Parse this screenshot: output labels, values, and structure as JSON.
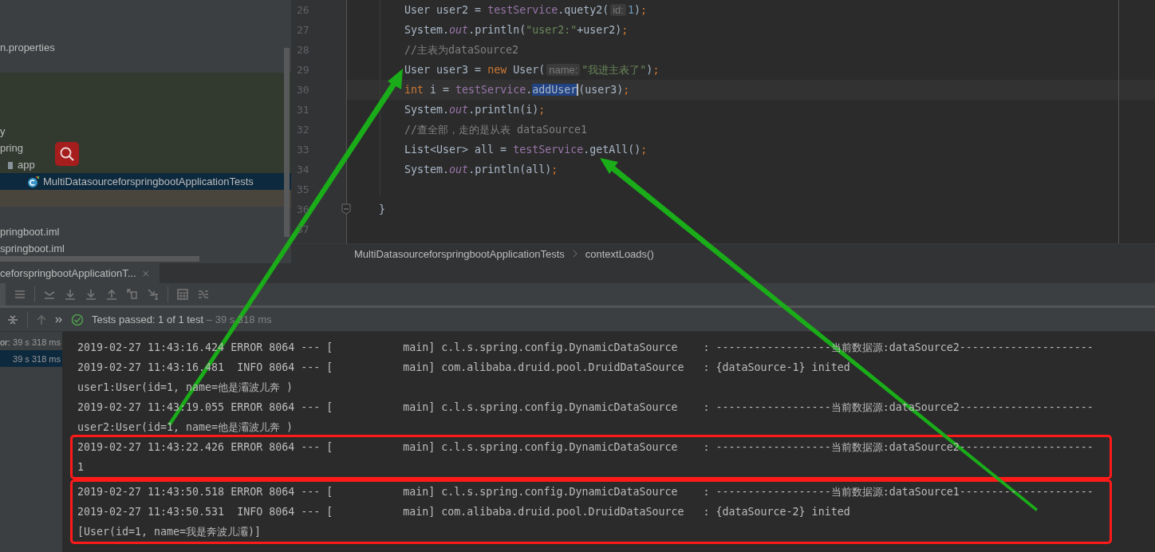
{
  "project_tree": {
    "items": [
      {
        "kind": "file",
        "label": "n.properties",
        "selected": false
      },
      {
        "kind": "blank",
        "selected": false
      },
      {
        "kind": "blank",
        "color": "#323a2f",
        "selected": false
      },
      {
        "kind": "blank",
        "color": "#323a2f",
        "selected": false
      },
      {
        "kind": "blank",
        "color": "#323a2f",
        "selected": false
      },
      {
        "kind": "file",
        "label": "y",
        "color": "#323a2f",
        "selected": false
      },
      {
        "kind": "file",
        "label": "pring",
        "color": "#323a2f",
        "selected": false,
        "children": [
          {
            "kind": "folder",
            "label": "app",
            "color": "#323a2f",
            "selected": false,
            "children": [
              {
                "kind": "test-class",
                "label": "MultiDatasourceforspringbootApplicationTests",
                "selected": true
              }
            ]
          }
        ]
      },
      {
        "kind": "blank",
        "color": "#49453d",
        "selected": false
      },
      {
        "kind": "blank",
        "selected": false
      },
      {
        "kind": "file",
        "label": "pringboot.iml",
        "selected": false
      },
      {
        "kind": "file",
        "label": "springboot.iml",
        "selected": false
      }
    ]
  },
  "editor": {
    "lines": [
      {
        "number": "26",
        "current": false,
        "fold": false,
        "tokens": [
          {
            "kind": "plain",
            "t": "        User user2 = "
          },
          {
            "kind": "field",
            "t": "testService"
          },
          {
            "kind": "plain",
            "t": ".quety2("
          },
          {
            "kind": "hint",
            "t": "id:"
          },
          {
            "kind": "number",
            "t": "1"
          },
          {
            "kind": "plain",
            "t": ")"
          },
          {
            "kind": "keyword",
            "t": ";"
          }
        ]
      },
      {
        "number": "27",
        "current": false,
        "fold": false,
        "tokens": [
          {
            "kind": "plain",
            "t": "        System."
          },
          {
            "kind": "static",
            "t": "out"
          },
          {
            "kind": "plain",
            "t": ".println("
          },
          {
            "kind": "string",
            "t": "\"user2:\""
          },
          {
            "kind": "plain",
            "t": "+user2)"
          },
          {
            "kind": "keyword",
            "t": ";"
          }
        ]
      },
      {
        "number": "28",
        "current": false,
        "fold": false,
        "tokens": [
          {
            "kind": "comment",
            "t": "        //主表为dataSource2"
          }
        ]
      },
      {
        "number": "29",
        "current": false,
        "fold": false,
        "tokens": [
          {
            "kind": "plain",
            "t": "        User user3 = "
          },
          {
            "kind": "keyword",
            "t": "new"
          },
          {
            "kind": "plain",
            "t": " User("
          },
          {
            "kind": "hint",
            "t": "name:"
          },
          {
            "kind": "string",
            "t": "\"我进主表了\""
          },
          {
            "kind": "plain",
            "t": ")"
          },
          {
            "kind": "keyword",
            "t": ";"
          }
        ]
      },
      {
        "number": "30",
        "current": true,
        "fold": false,
        "tokens": [
          {
            "kind": "keyword",
            "t": "        int"
          },
          {
            "kind": "plain",
            "t": " i = "
          },
          {
            "kind": "field",
            "t": "testService"
          },
          {
            "kind": "plain",
            "t": "."
          },
          {
            "kind": "selection",
            "t": "addUser"
          },
          {
            "kind": "plain",
            "t": "(user3)"
          },
          {
            "kind": "keyword",
            "t": ";"
          }
        ]
      },
      {
        "number": "31",
        "current": false,
        "fold": false,
        "tokens": [
          {
            "kind": "plain",
            "t": "        System."
          },
          {
            "kind": "static",
            "t": "out"
          },
          {
            "kind": "plain",
            "t": ".println(i)"
          },
          {
            "kind": "keyword",
            "t": ";"
          }
        ]
      },
      {
        "number": "32",
        "current": false,
        "fold": false,
        "tokens": [
          {
            "kind": "comment",
            "t": "        //查全部，走的是从表 dataSource1"
          }
        ]
      },
      {
        "number": "33",
        "current": false,
        "fold": false,
        "tokens": [
          {
            "kind": "plain",
            "t": "        List<User> all = "
          },
          {
            "kind": "field",
            "t": "testService"
          },
          {
            "kind": "plain",
            "t": ".getAll()"
          },
          {
            "kind": "keyword",
            "t": ";"
          }
        ]
      },
      {
        "number": "34",
        "current": false,
        "fold": false,
        "tokens": [
          {
            "kind": "plain",
            "t": "        System."
          },
          {
            "kind": "static",
            "t": "out"
          },
          {
            "kind": "plain",
            "t": ".println(all)"
          },
          {
            "kind": "keyword",
            "t": ";"
          }
        ]
      },
      {
        "number": "35",
        "current": false,
        "fold": false
      },
      {
        "number": "36",
        "current": false,
        "fold": true,
        "tokens": [
          {
            "kind": "plain",
            "t": "    }"
          }
        ]
      },
      {
        "number": "37",
        "current": false,
        "fold": false
      }
    ]
  },
  "breadcrumbs": [
    "MultiDatasourceforspringbootApplicationTests",
    "contextLoads()"
  ],
  "run_tabs": [
    {
      "label": "ceforspringbootApplicationT...",
      "selected": true
    }
  ],
  "status": {
    "label": "Tests passed:",
    "count": "1 of 1 test",
    "duration": "– 39 s 318 ms"
  },
  "test_results": [
    {
      "label": "or:",
      "duration": "39 s 318 ms",
      "selected": false
    },
    {
      "duration": "39 s 318 ms",
      "selected": true
    }
  ],
  "console": {
    "groups": [
      {
        "highlighted": false,
        "lines": [
          "2019-02-27 11:43:16.424 ERROR 8064 --- [           main] c.l.s.spring.config.DynamicDataSource    : ------------------当前数据源:dataSource2---------------------",
          "2019-02-27 11:43:16.481  INFO 8064 --- [           main] com.alibaba.druid.pool.DruidDataSource   : {dataSource-1} inited",
          "user1:User(id=1, name=他是灞波儿奔 )",
          "2019-02-27 11:43:19.055 ERROR 8064 --- [           main] c.l.s.spring.config.DynamicDataSource    : ------------------当前数据源:dataSource2---------------------",
          "user2:User(id=1, name=他是灞波儿奔 )"
        ]
      },
      {
        "highlighted": true,
        "lines": [
          "2019-02-27 11:43:22.426 ERROR 8064 --- [           main] c.l.s.spring.config.DynamicDataSource    : ------------------当前数据源:dataSource2---------------------",
          "1"
        ]
      },
      {
        "highlighted": true,
        "lines": [
          "2019-02-27 11:43:50.518 ERROR 8064 --- [           main] c.l.s.spring.config.DynamicDataSource    : ------------------当前数据源:dataSource1---------------------",
          "2019-02-27 11:43:50.531  INFO 8064 --- [           main] com.alibaba.druid.pool.DruidDataSource   : {dataSource-2} inited",
          "[User(id=1, name=我是奔波儿灞)]"
        ]
      }
    ]
  }
}
